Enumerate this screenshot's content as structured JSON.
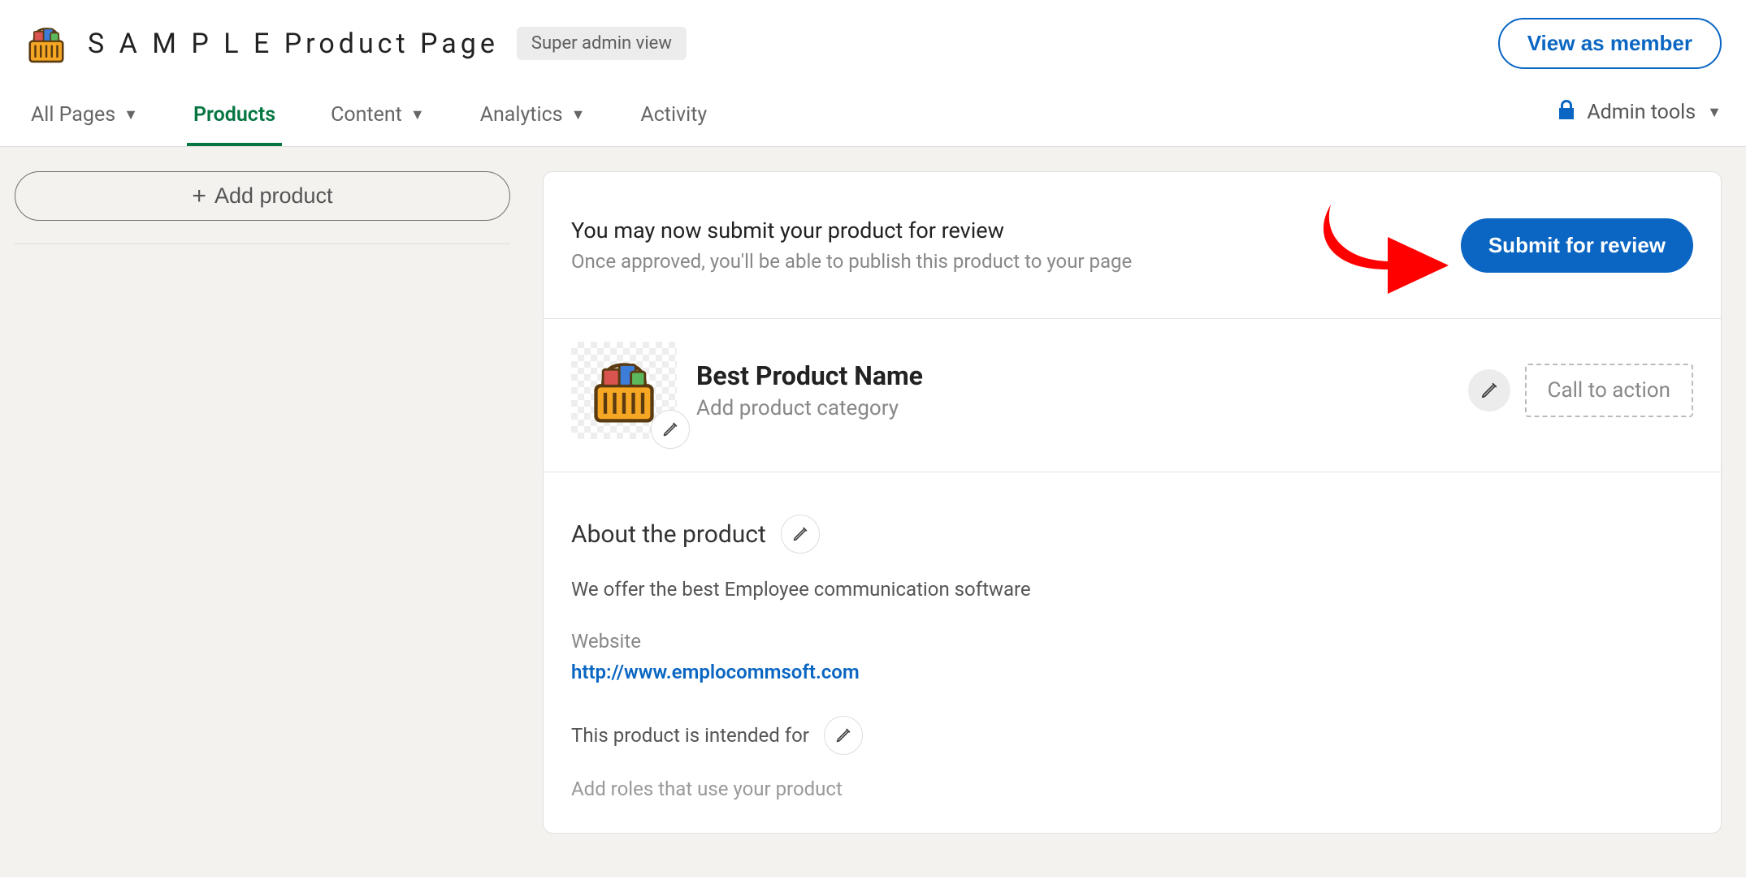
{
  "header": {
    "page_title": "S A M P L E Product Page",
    "badge": "Super admin view",
    "view_as_member": "View as member"
  },
  "nav": {
    "tabs": [
      {
        "label": "All Pages",
        "has_caret": true,
        "active": false
      },
      {
        "label": "Products",
        "has_caret": false,
        "active": true
      },
      {
        "label": "Content",
        "has_caret": true,
        "active": false
      },
      {
        "label": "Analytics",
        "has_caret": true,
        "active": false
      },
      {
        "label": "Activity",
        "has_caret": false,
        "active": false
      }
    ],
    "admin_tools": "Admin tools"
  },
  "sidebar": {
    "add_product": "Add product"
  },
  "review": {
    "title": "You may now submit your product for review",
    "subtitle": "Once approved, you'll be able to publish this product to your page",
    "submit_label": "Submit for review"
  },
  "product": {
    "name": "Best Product Name",
    "category_placeholder": "Add product category",
    "cta_placeholder": "Call to action"
  },
  "about": {
    "heading": "About the product",
    "description": "We offer the best Employee communication software",
    "website_label": "Website",
    "website_url": "http://www.emplocommsoft.com",
    "intended_label": "This product is intended for",
    "roles_placeholder": "Add roles that use your product"
  },
  "icons": {
    "basket": "basket-icon",
    "pencil": "pencil-icon",
    "lock": "lock-icon",
    "chevron_down": "chevron-down-icon",
    "plus": "plus-icon",
    "arrow": "arrow-callout-icon"
  }
}
